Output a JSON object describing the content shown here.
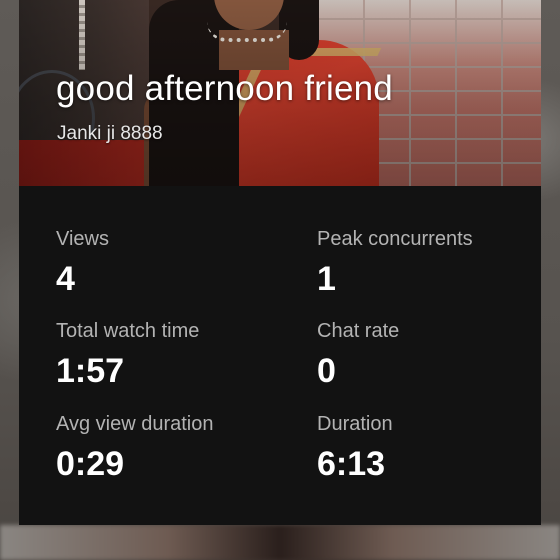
{
  "video": {
    "title": "good afternoon friend",
    "channel": "Janki ji 8888"
  },
  "stats": [
    {
      "label": "Views",
      "value": "4"
    },
    {
      "label": "Peak concurrents",
      "value": "1"
    },
    {
      "label": "Total watch time",
      "value": "1:57"
    },
    {
      "label": "Chat rate",
      "value": "0"
    },
    {
      "label": "Avg view duration",
      "value": "0:29"
    },
    {
      "label": "Duration",
      "value": "6:13"
    }
  ],
  "colors": {
    "card_background": "#121212",
    "label_text": "#b3b3b3",
    "value_text": "#ffffff"
  }
}
